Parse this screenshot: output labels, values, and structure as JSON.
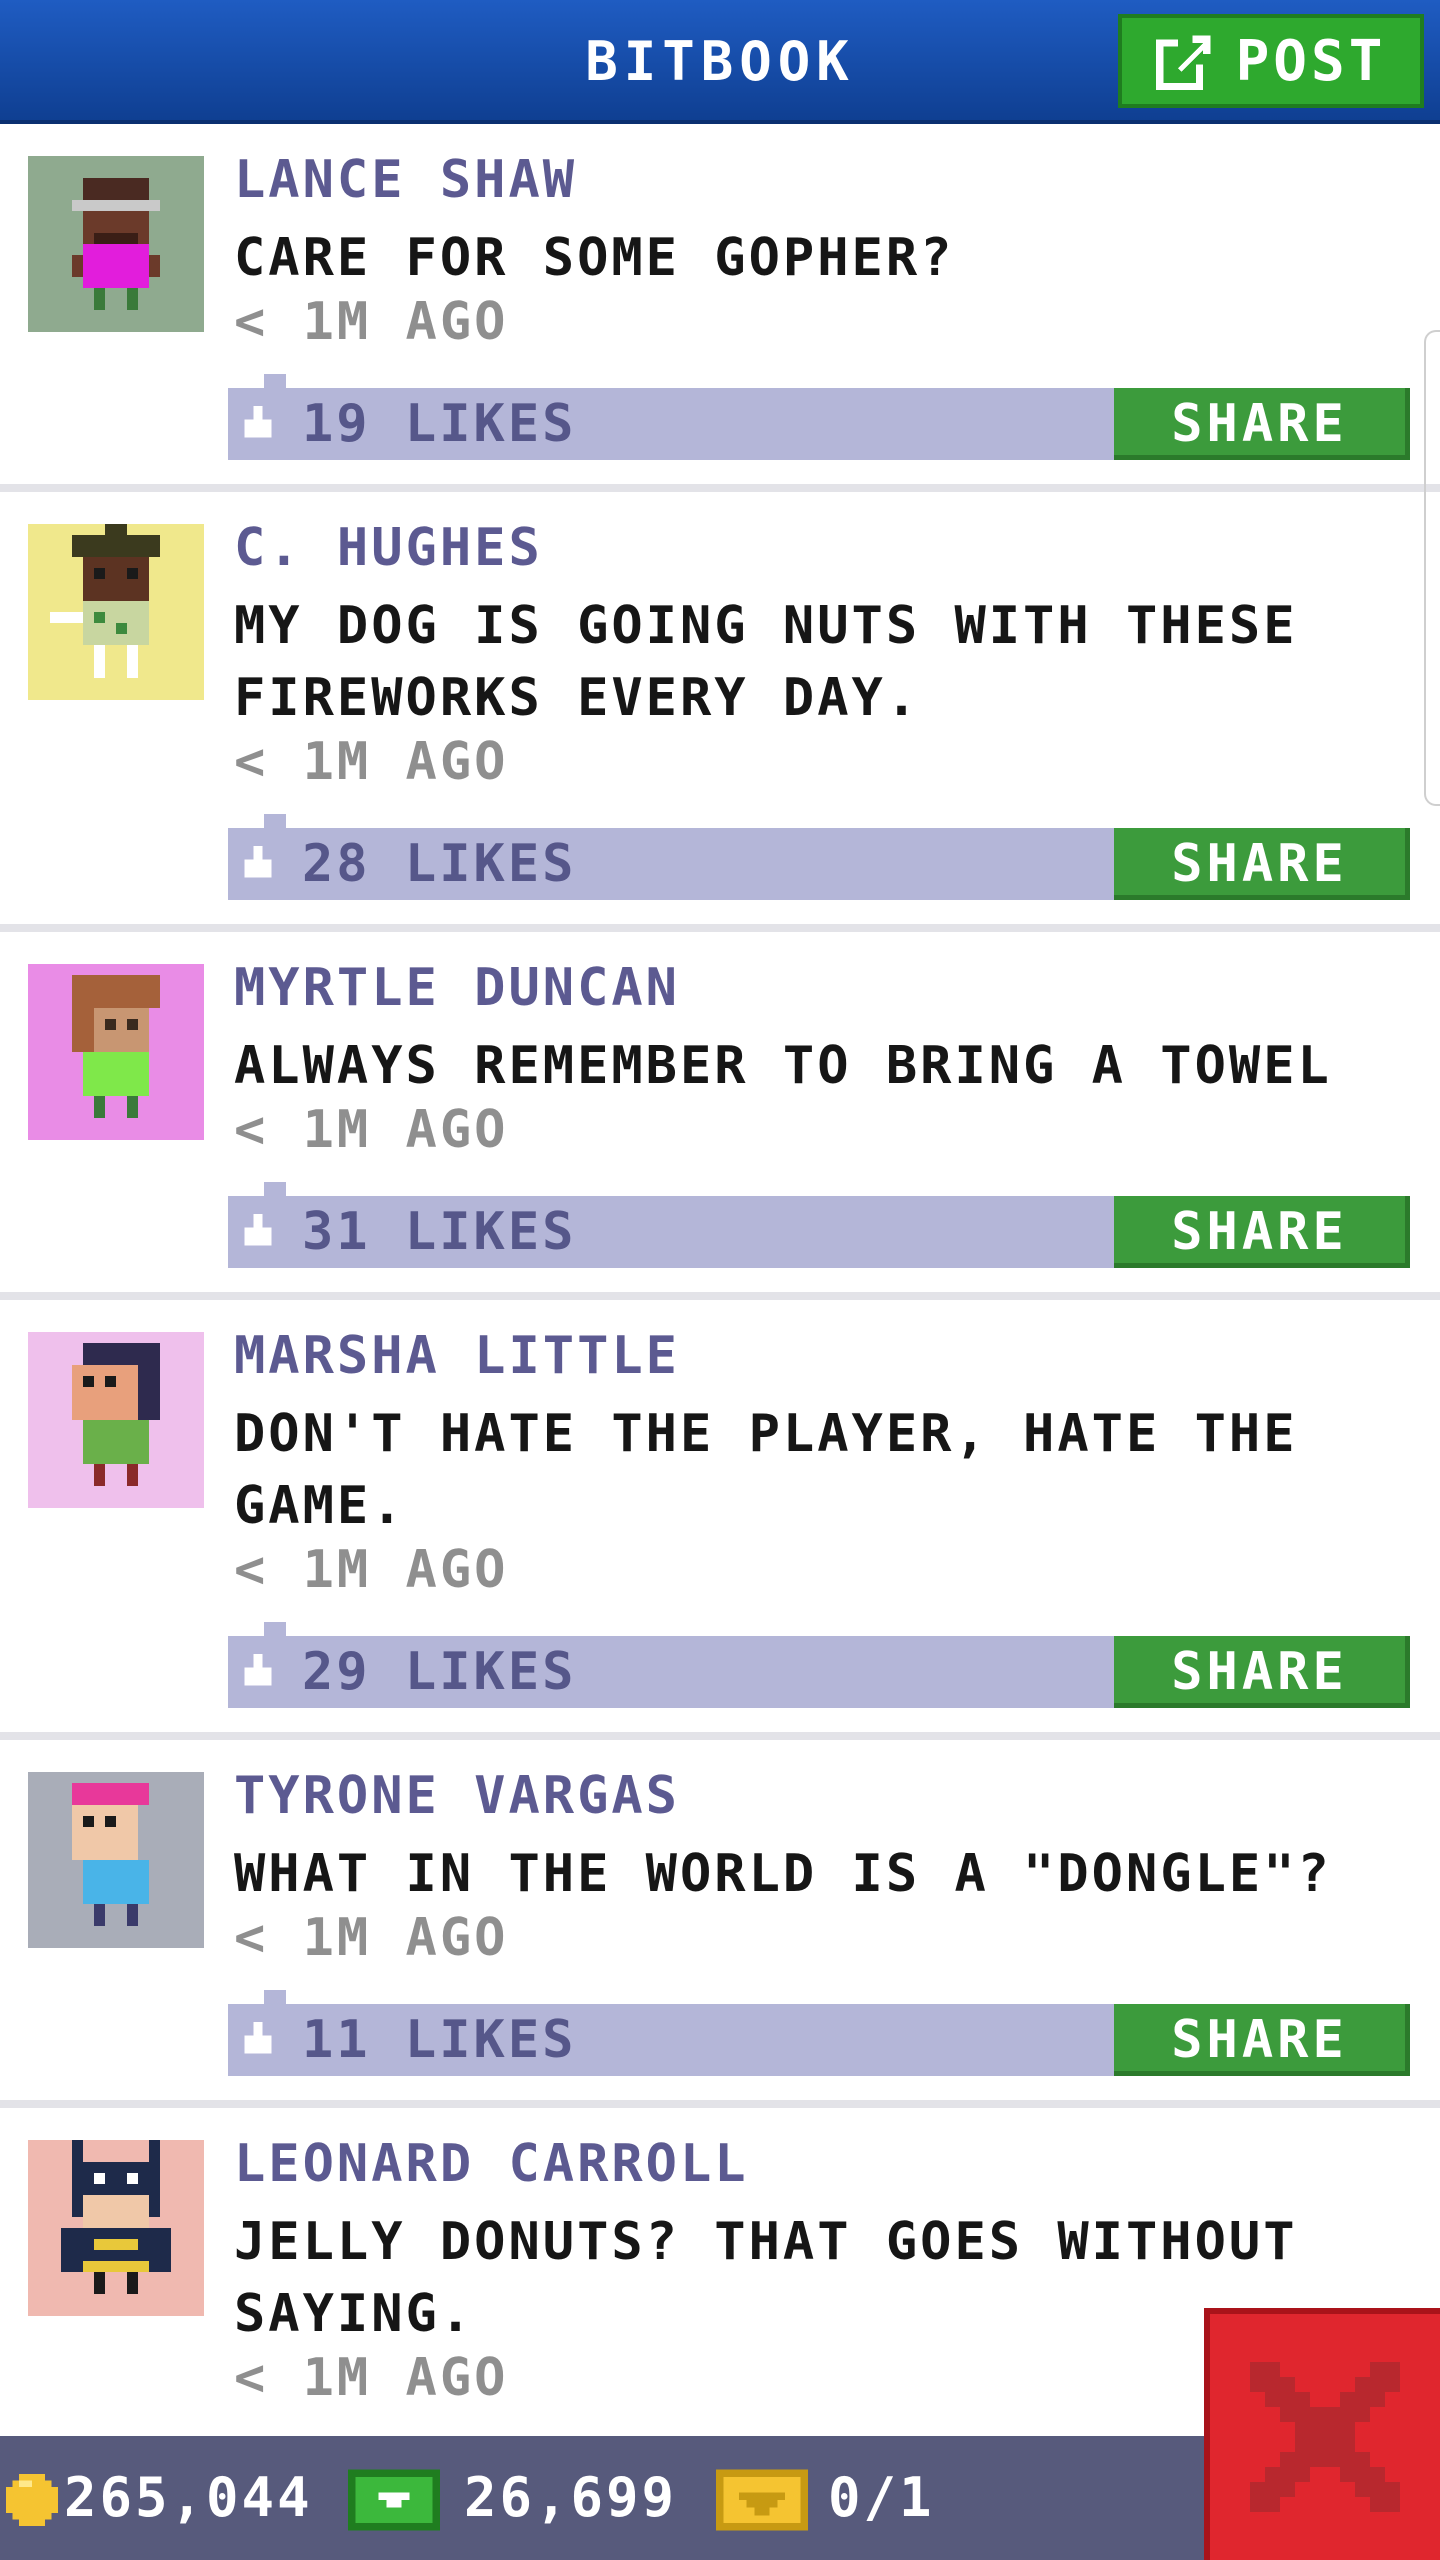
{
  "header": {
    "title": "BITBOOK",
    "post_label": "POST",
    "post_icon": "edit-square-icon"
  },
  "posts": [
    {
      "author": "LANCE SHAW",
      "message": "CARE FOR SOME GOPHER?",
      "time": "< 1M AGO",
      "likes": "19 LIKES",
      "share_label": "SHARE",
      "avatar_bg": "#8faa8f"
    },
    {
      "author": "C. HUGHES",
      "message": "MY DOG IS GOING NUTS WITH THESE FIREWORKS EVERY DAY.",
      "time": "< 1M AGO",
      "likes": "28 LIKES",
      "share_label": "SHARE",
      "avatar_bg": "#f0e88c"
    },
    {
      "author": "MYRTLE DUNCAN",
      "message": "ALWAYS REMEMBER TO BRING A TOWEL",
      "time": "< 1M AGO",
      "likes": "31 LIKES",
      "share_label": "SHARE",
      "avatar_bg": "#e98ce6"
    },
    {
      "author": "MARSHA LITTLE",
      "message": "DON'T HATE THE PLAYER, HATE THE GAME.",
      "time": "< 1M AGO",
      "likes": "29 LIKES",
      "share_label": "SHARE",
      "avatar_bg": "#efc0ec"
    },
    {
      "author": "TYRONE VARGAS",
      "message": "WHAT IN THE WORLD IS A \"DONGLE\"?",
      "time": "< 1M AGO",
      "likes": "11 LIKES",
      "share_label": "SHARE",
      "avatar_bg": "#a9adb8"
    },
    {
      "author": "LEONARD CARROLL",
      "message": "JELLY DONUTS? THAT GOES WITHOUT SAYING.",
      "time": "< 1M AGO",
      "avatar_bg": "#f0b9b0"
    }
  ],
  "status": {
    "coins": "265,044",
    "bux": "26,699",
    "tickets": "0/1",
    "coin_icon": "coin-icon",
    "bux_icon": "bux-icon",
    "ticket_icon": "ticket-icon"
  },
  "close_icon": "close-icon",
  "colors": {
    "header_blue": "#1f5cc2",
    "accent_green": "#3c9b3c",
    "likes_bar": "#b4b6d8",
    "author_purple": "#5c5a91",
    "close_red": "#e0262e"
  }
}
